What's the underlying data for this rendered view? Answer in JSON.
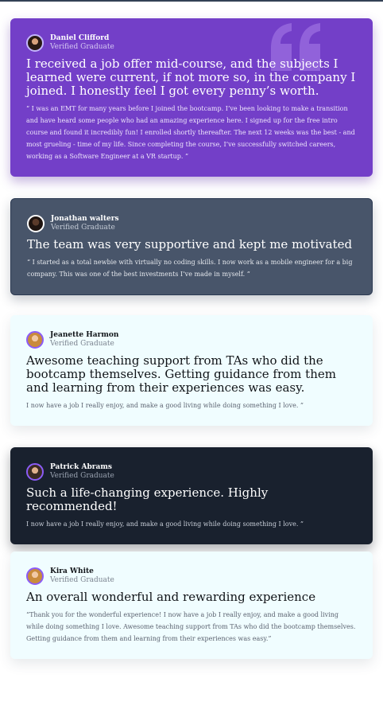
{
  "testimonials": [
    {
      "theme": "violet",
      "name": "Daniel Clifford",
      "status": "Verified Graduate",
      "headline": "I received a job offer mid-course, and the subjects I learned were current, if not more so, in the company I joined. I honestly feel I got every penny’s worth.",
      "body": "“ I was an EMT for many years before I joined the bootcamp. I’ve been looking to make a transition and have heard some people who had an amazing experience here. I signed up for the free intro course and found it incredibly fun! I enrolled shortly thereafter. The next 12 weeks was the best - and most grueling - time of my life. Since completing the course, I’ve successfully switched careers, working as a Software Engineer at a VR startup. ”"
    },
    {
      "theme": "slate",
      "name": "Jonathan walters",
      "status": "Verified Graduate",
      "headline": "The team was very supportive and kept me motivated",
      "body": "“ I started as a total newbie with virtually no coding skills. I now work as a mobile engineer for a big company. This was one of the best investments I’ve made in myself. ”"
    },
    {
      "theme": "light",
      "name": "Jeanette Harmon",
      "status": "Verified Graduate",
      "headline": "Awesome teaching support from TAs who did the bootcamp themselves. Getting guidance from them and learning from their experiences was easy.",
      "body": "I now have a job I really enjoy, and make a good living while doing something I love. ”"
    },
    {
      "theme": "dark",
      "name": "Patrick Abrams",
      "status": "Verified Graduate",
      "headline": "Such a life-changing experience. Highly recommended!",
      "body": "I now have a job I really enjoy, and make a good living while doing something I love. ”"
    },
    {
      "theme": "light",
      "name": "Kira White",
      "status": "Verified Graduate",
      "headline": "An overall wonderful and rewarding experience",
      "body": "“Thank you for the wonderful experience! I now have a job I really enjoy, and make a good living while doing something I love. Awesome teaching support from TAs who did the bootcamp themselves. Getting guidance from them and learning from their experiences was easy.”"
    }
  ],
  "icons": {
    "quote": "quote-icon",
    "avatar": "avatar"
  },
  "colors": {
    "violet": "#733fc8",
    "slate": "#48556a",
    "light": "#f0fdff",
    "dark": "#19212e",
    "avatar_border": "#a855f7"
  }
}
